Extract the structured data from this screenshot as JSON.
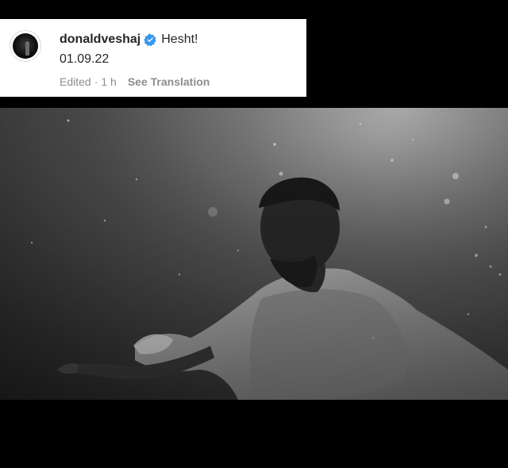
{
  "post": {
    "username": "donaldveshaj",
    "caption": "Hesht!",
    "date_line": "01.09.22",
    "edited_label": "Edited",
    "separator": "·",
    "time_ago": "1 h",
    "see_translation": "See Translation"
  },
  "icons": {
    "verified": "verified-badge-icon",
    "avatar": "profile-avatar"
  },
  "colors": {
    "verified_blue": "#3897f0",
    "text_primary": "#262626",
    "text_secondary": "#8e8e8e",
    "card_background": "#ffffff",
    "page_background": "#000000"
  },
  "photo": {
    "description_type": "black-and-white underwater portrait"
  }
}
